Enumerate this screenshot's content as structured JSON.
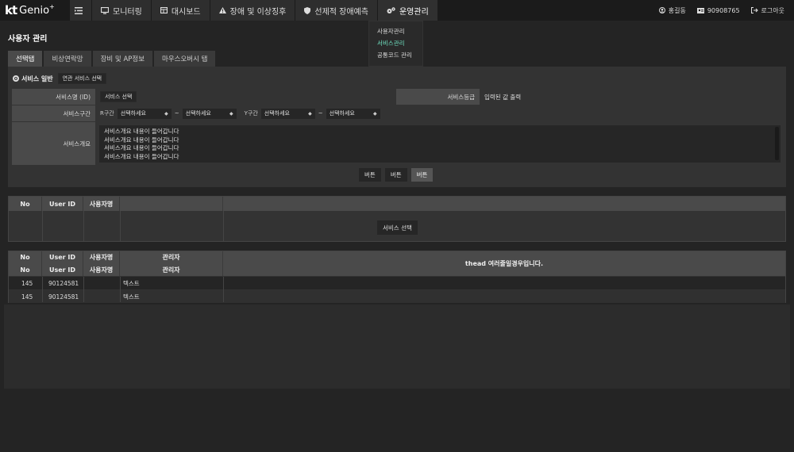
{
  "app": {
    "logo_kt": "kt",
    "logo_name": "Genio",
    "logo_sup": "+"
  },
  "nav": {
    "items": [
      {
        "label": "모니터링",
        "icon": "monitor-icon"
      },
      {
        "label": "대시보드",
        "icon": "dashboard-icon"
      },
      {
        "label": "장애 및 이상징후",
        "icon": "warning-icon"
      },
      {
        "label": "선제적 장애예측",
        "icon": "shield-icon"
      },
      {
        "label": "운영관리",
        "icon": "gears-icon"
      }
    ],
    "dropdown": [
      "사용자관리",
      "서비스관리",
      "공통코드 관리"
    ]
  },
  "user": {
    "name": "홍길동",
    "id": "90908765",
    "logout": "로그아웃"
  },
  "page": {
    "title": "사용자 관리"
  },
  "tabs": [
    "선택탭",
    "비상연락망",
    "장비 및 AP정보",
    "마우스오버시 탭"
  ],
  "form": {
    "radio_label": "서비스 일반",
    "related_btn": "연관 서비스 선택",
    "service_name_label": "서비스명 (ID)",
    "service_select_btn": "서비스 선택",
    "grade_label": "서비스등급",
    "grade_value": "입력된 값 출력",
    "range_label": "서비스구간",
    "r_label": "R구간",
    "y_label": "Y구간",
    "select_placeholder": "선택하세요",
    "tilde": "~",
    "summary_label": "서비스개요",
    "summary_lines": [
      "서비스개요 내용이 들어갑니다",
      "서비스개요 내용이 들어갑니다",
      "서비스개요 내용이 들어갑니다",
      "서비스개요 내용이 들어갑니다"
    ],
    "buttons": [
      "버튼",
      "버튼",
      "버튼"
    ]
  },
  "table1": {
    "headers": [
      "No",
      "User ID",
      "사용자명"
    ],
    "center_btn": "서비스 선택"
  },
  "table2": {
    "headers_row1": [
      "No",
      "User ID",
      "사용자명",
      "관리자"
    ],
    "headers_row2": [
      "No",
      "User ID",
      "사용자명",
      "관리자"
    ],
    "note": "thead 여러줄일경우입니다.",
    "rows": [
      {
        "no": "145",
        "user_id": "90124581",
        "name": "",
        "admin": "텍스트"
      },
      {
        "no": "145",
        "user_id": "90124581",
        "name": "",
        "admin": "텍스트"
      }
    ]
  }
}
